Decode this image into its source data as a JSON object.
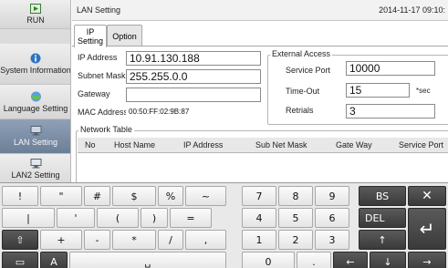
{
  "sidebar": {
    "items": [
      {
        "label": "RUN"
      },
      {
        "label": "System Information"
      },
      {
        "label": "Language Setting"
      },
      {
        "label": "LAN Setting"
      },
      {
        "label": "LAN2 Setting"
      }
    ]
  },
  "header": {
    "title": "LAN Setting",
    "datetime": "2014-11-17  09:10:"
  },
  "tabs": [
    {
      "label": "IP Setting",
      "active": true
    },
    {
      "label": "Option",
      "active": false
    }
  ],
  "ip_setting": {
    "ip_address_label": "IP Address",
    "ip_address_value": "10.91.130.188",
    "subnet_mask_label": "Subnet Mask",
    "subnet_mask_value": "255.255.0.0",
    "gateway_label": "Gateway",
    "gateway_value": "",
    "mac_address_label": "MAC Address",
    "mac_address_value": "00:50:FF:02:9B:87"
  },
  "external_access": {
    "title": "External Access",
    "service_port_label": "Service Port",
    "service_port_value": "10000",
    "timeout_label": "Time-Out",
    "timeout_value": "15",
    "timeout_unit": "*sec",
    "retrials_label": "Retrials",
    "retrials_value": "3"
  },
  "network_table": {
    "title": "Network Table",
    "columns": [
      "No",
      "Host Name",
      "IP Address",
      "Sub Net Mask",
      "Gate Way",
      "Service Port"
    ]
  },
  "keyboard": {
    "row1": [
      "!",
      "\"",
      "#",
      "$",
      "%",
      "~",
      "7",
      "8",
      "9",
      "BS",
      "✕"
    ],
    "row2": [
      "|",
      "'",
      "(",
      ")",
      "=",
      "4",
      "5",
      "6",
      "DEL",
      "↵"
    ],
    "row3": [
      "⇧",
      "+",
      "-",
      "*",
      "/",
      ",",
      "1",
      "2",
      "3",
      "↑"
    ],
    "row4": [
      "▭",
      "A",
      "␣",
      "0",
      ".",
      "←",
      "↓",
      "→"
    ]
  },
  "colors": {
    "sidebar_active": "#7b8da5",
    "key_dark": "#4a4a4a"
  }
}
